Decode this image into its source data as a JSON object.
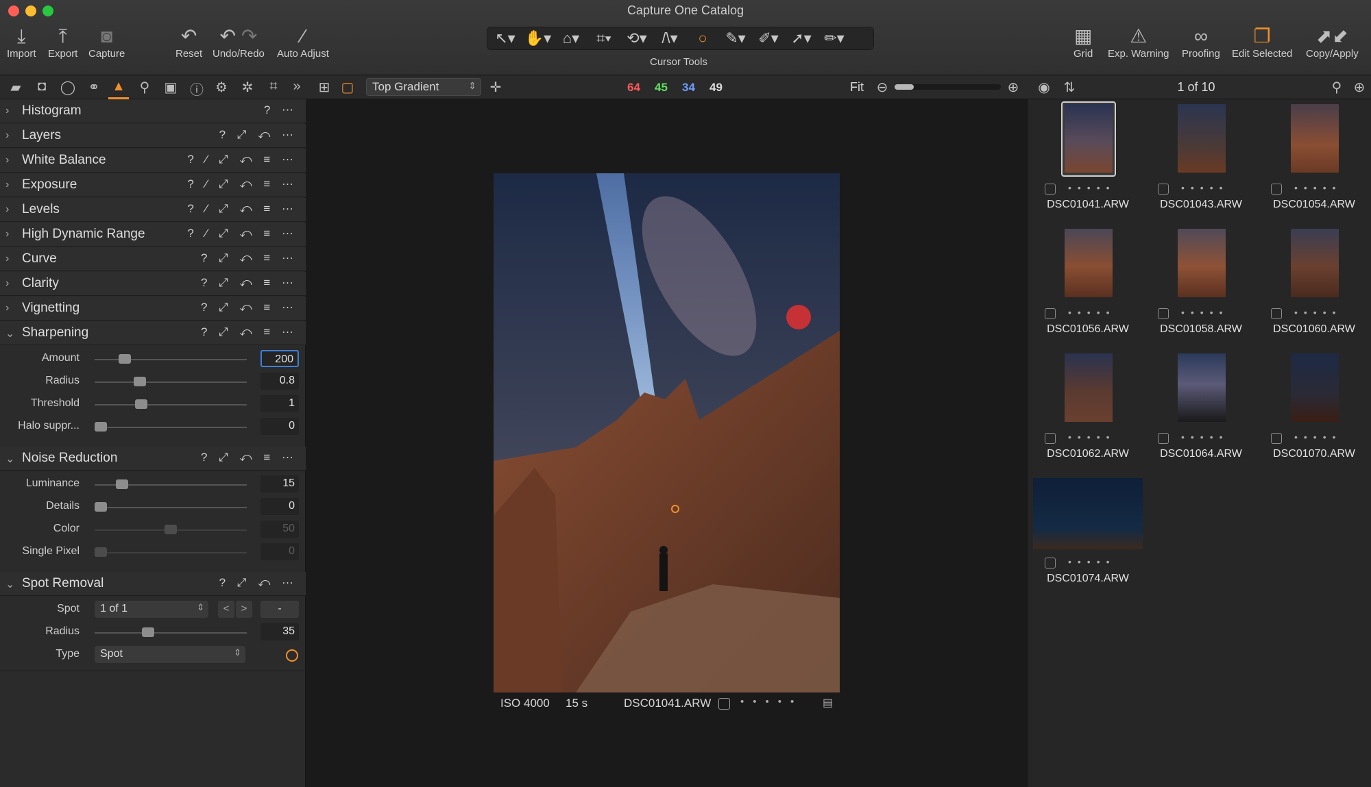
{
  "window": {
    "title": "Capture One Catalog"
  },
  "toolbar": {
    "left": [
      {
        "label": "Import",
        "icon": "import-icon"
      },
      {
        "label": "Export",
        "icon": "export-icon"
      },
      {
        "label": "Capture",
        "icon": "camera-icon"
      },
      {
        "label": "Reset",
        "icon": "reset-icon"
      },
      {
        "label": "Undo/Redo",
        "icon": "undo-redo-icon"
      },
      {
        "label": "Auto Adjust",
        "icon": "magic-wand-icon"
      }
    ],
    "cursor_tools_label": "Cursor Tools",
    "right": [
      {
        "label": "Grid",
        "icon": "grid-icon"
      },
      {
        "label": "Exp. Warning",
        "icon": "warning-icon"
      },
      {
        "label": "Proofing",
        "icon": "glasses-icon"
      },
      {
        "label": "Edit Selected",
        "icon": "edit-selected-icon"
      },
      {
        "label": "Copy/Apply",
        "icon": "copy-apply-icon"
      }
    ]
  },
  "viewer_bar": {
    "mask_select": "Top Gradient",
    "rgb": {
      "r": "64",
      "g": "45",
      "b": "34",
      "l": "49"
    },
    "zoom_label": "Fit",
    "accent": "#f0902a"
  },
  "browser_bar": {
    "count": "1 of 10"
  },
  "tools": [
    {
      "label": "Histogram"
    },
    {
      "label": "Layers"
    },
    {
      "label": "White Balance"
    },
    {
      "label": "Exposure"
    },
    {
      "label": "Levels"
    },
    {
      "label": "High Dynamic Range"
    },
    {
      "label": "Curve"
    },
    {
      "label": "Clarity"
    },
    {
      "label": "Vignetting"
    },
    {
      "label": "Sharpening"
    }
  ],
  "sharpening": [
    {
      "label": "Amount",
      "value": "200",
      "level": 0.17
    },
    {
      "label": "Radius",
      "value": "0.8",
      "level": 0.28
    },
    {
      "label": "Threshold",
      "value": "1",
      "level": 0.29
    },
    {
      "label": "Halo suppr...",
      "value": "0",
      "level": 0.0
    }
  ],
  "noise": {
    "title": "Noise Reduction",
    "params": [
      {
        "label": "Luminance",
        "value": "15",
        "level": 0.15
      },
      {
        "label": "Details",
        "value": "0",
        "level": 0.0
      },
      {
        "label": "Color",
        "value": "50",
        "level": 0.5
      },
      {
        "label": "Single Pixel",
        "value": "0",
        "level": 0.0
      }
    ]
  },
  "spot": {
    "title": "Spot Removal",
    "spot_label": "Spot",
    "spot_value": "1 of 1",
    "prev": "<",
    "next": ">",
    "minus": "-",
    "radius_label": "Radius",
    "radius_value": "35",
    "radius_level": 0.34,
    "type_label": "Type",
    "type_value": "Spot"
  },
  "image_meta": {
    "iso": "ISO 4000",
    "shutter": "15 s",
    "filename": "DSC01041.ARW"
  },
  "thumbnails": [
    {
      "name": "DSC01041.ARW"
    },
    {
      "name": "DSC01043.ARW"
    },
    {
      "name": "DSC01054.ARW"
    },
    {
      "name": "DSC01056.ARW"
    },
    {
      "name": "DSC01058.ARW"
    },
    {
      "name": "DSC01060.ARW"
    },
    {
      "name": "DSC01062.ARW"
    },
    {
      "name": "DSC01064.ARW"
    },
    {
      "name": "DSC01070.ARW"
    },
    {
      "name": "DSC01074.ARW"
    }
  ]
}
